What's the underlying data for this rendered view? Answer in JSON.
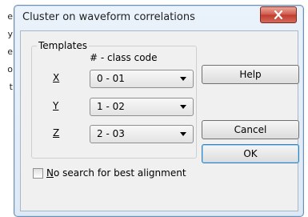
{
  "background": {
    "fragments": [
      "e",
      "y",
      "e",
      "o",
      "t"
    ]
  },
  "dialog": {
    "title": "Cluster on waveform correlations",
    "templates": {
      "group_label": "Templates",
      "column_header": "# - class code",
      "rows": [
        {
          "label": "X",
          "value": "0 - 01"
        },
        {
          "label": "Y",
          "value": "1 - 02"
        },
        {
          "label": "Z",
          "value": "2 - 03"
        }
      ]
    },
    "buttons": {
      "help": "Help",
      "cancel": "Cancel",
      "ok": "OK"
    },
    "checkbox": {
      "label": "No search for best alignment",
      "checked": false
    }
  },
  "colors": {
    "close_button": "#c8473a",
    "title_bar": "#dde9f6",
    "default_button_border": "#3c7fb1"
  }
}
